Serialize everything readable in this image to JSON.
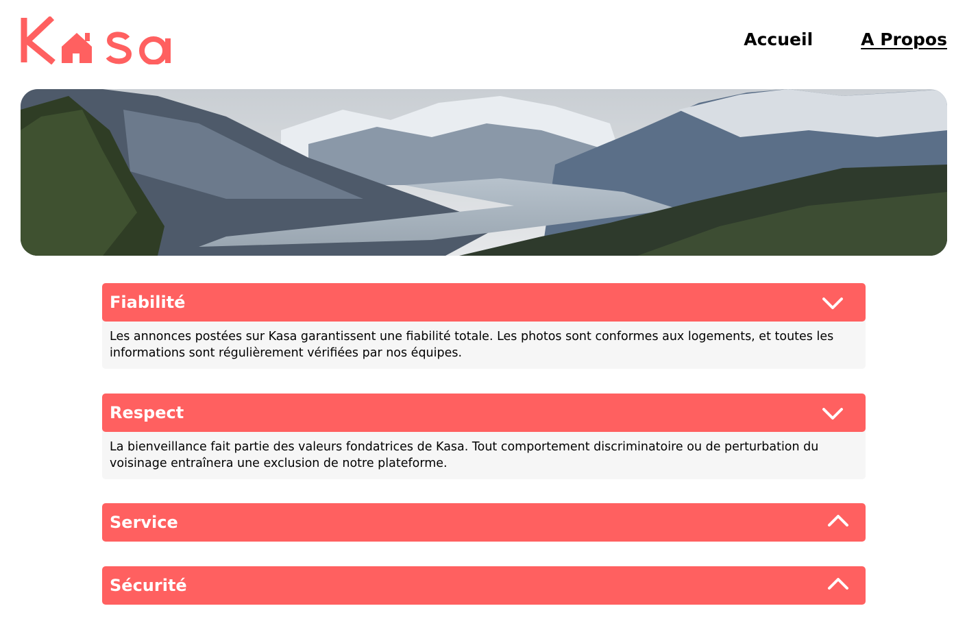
{
  "brand": {
    "logo_text": "Kasa",
    "color": "#FF6060"
  },
  "nav": {
    "items": [
      {
        "label": "Accueil"
      },
      {
        "label": "A Propos"
      }
    ]
  },
  "banner": {
    "image": "mountain-valley-landscape"
  },
  "collapses": [
    {
      "title": "Fiabilité",
      "expanded": true,
      "icon": "chevron-down-icon",
      "content": "Les annonces postées sur Kasa garantissent une fiabilité totale. Les photos sont conformes aux logements, et toutes les informations sont régulièrement vérifiées par nos équipes."
    },
    {
      "title": "Respect",
      "expanded": true,
      "icon": "chevron-down-icon",
      "content": "La bienveillance fait partie des valeurs fondatrices de Kasa. Tout comportement discriminatoire ou de perturbation du voisinage entraînera une exclusion de notre plateforme."
    },
    {
      "title": "Service",
      "expanded": false,
      "icon": "chevron-up-icon"
    },
    {
      "title": "Sécurité",
      "expanded": false,
      "icon": "chevron-up-icon"
    }
  ]
}
